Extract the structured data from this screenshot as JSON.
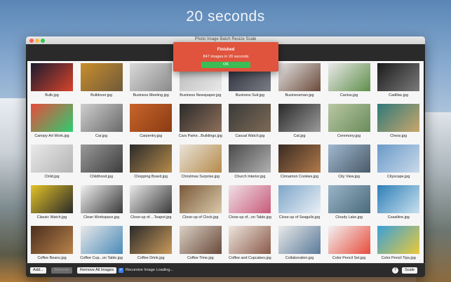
{
  "hero": {
    "title": "20 seconds"
  },
  "window": {
    "title": "Photo Image Batch Resize Scale"
  },
  "dialog": {
    "heading": "Finished",
    "message": "847 images in 20 seconds",
    "ok_label": "OK"
  },
  "bottombar": {
    "add_label": "Add...",
    "remove_label": "Remove",
    "remove_all_label": "Remove All Images",
    "recursive_label": "Recursive Image Loading...",
    "recursive_checked": true,
    "help_label": "?",
    "scale_label": "Scale"
  },
  "images": [
    {
      "name": "Bulb.jpg",
      "c1": "#1b1b2e",
      "c2": "#d7442c"
    },
    {
      "name": "Bulldozer.jpg",
      "c1": "#c98e2c",
      "c2": "#6f5a3a"
    },
    {
      "name": "Business Meeting.jpg",
      "c1": "#d9d9d9",
      "c2": "#8a8a8a"
    },
    {
      "name": "Business Newspaper.jpg",
      "c1": "#b9b9b9",
      "c2": "#e8e8e8"
    },
    {
      "name": "Business Suit.jpg",
      "c1": "#2a2d3a",
      "c2": "#7b7c85"
    },
    {
      "name": "Businessman.jpg",
      "c1": "#e2e2e2",
      "c2": "#6b4a3a"
    },
    {
      "name": "Cactus.jpg",
      "c1": "#e9e9e9",
      "c2": "#5f8f4a"
    },
    {
      "name": "Cadillac.jpg",
      "c1": "#1b1b1b",
      "c2": "#7a7a7a"
    },
    {
      "name": "Canopy Art Work.jpg",
      "c1": "#e74c3c",
      "c2": "#2ecc71"
    },
    {
      "name": "Car.jpg",
      "c1": "#cfcfcf",
      "c2": "#6a6a6a"
    },
    {
      "name": "Carpentry.jpg",
      "c1": "#c8652a",
      "c2": "#8a3b14"
    },
    {
      "name": "Cars Parke...Buildings.jpg",
      "c1": "#2b2b2b",
      "c2": "#8e6f5a"
    },
    {
      "name": "Casual Watch.jpg",
      "c1": "#3a3a3a",
      "c2": "#7d6a55"
    },
    {
      "name": "Cat.jpg",
      "c1": "#2a2a2a",
      "c2": "#9a9a9a"
    },
    {
      "name": "Ceremony.jpg",
      "c1": "#b9c7a4",
      "c2": "#6a8c5a"
    },
    {
      "name": "Chess.jpg",
      "c1": "#2f7a7a",
      "c2": "#c9a66b"
    },
    {
      "name": "Child.jpg",
      "c1": "#e9e9e9",
      "c2": "#b4b4b4"
    },
    {
      "name": "Childhood.jpg",
      "c1": "#9a9a9a",
      "c2": "#3d3d3d"
    },
    {
      "name": "Chopping Board.jpg",
      "c1": "#2b2b2b",
      "c2": "#b58a4a"
    },
    {
      "name": "Christmas Surprise.jpg",
      "c1": "#e9e3d9",
      "c2": "#b58a4a"
    },
    {
      "name": "Church Interior.jpg",
      "c1": "#4a4a4a",
      "c2": "#b0b0b0"
    },
    {
      "name": "Cinnamon Cookies.jpg",
      "c1": "#3a2a22",
      "c2": "#b07a4a"
    },
    {
      "name": "City View.jpg",
      "c1": "#9fb8cf",
      "c2": "#4a5a6a"
    },
    {
      "name": "Cityscape.jpg",
      "c1": "#6a9ac9",
      "c2": "#c9d9e9"
    },
    {
      "name": "Classic Watch.jpg",
      "c1": "#e3c227",
      "c2": "#2a2a2a"
    },
    {
      "name": "Clean Workspace.jpg",
      "c1": "#f1f1f1",
      "c2": "#3a3a3a"
    },
    {
      "name": "Close-up of....Teapot.jpg",
      "c1": "#e9e9e9",
      "c2": "#3a3a3a"
    },
    {
      "name": "Close-up of Clock.jpg",
      "c1": "#7a5a3a",
      "c2": "#d9c9a9"
    },
    {
      "name": "Close-up of...on Table.jpg",
      "c1": "#f0e0e6",
      "c2": "#c75a7a"
    },
    {
      "name": "Close-up of Seagulls.jpg",
      "c1": "#7ea6c9",
      "c2": "#e9eff5"
    },
    {
      "name": "Cloudy Lake.jpg",
      "c1": "#9ab4c9",
      "c2": "#4a6a7a"
    },
    {
      "name": "Coastline.jpg",
      "c1": "#2e7fb8",
      "c2": "#c9e0ee"
    },
    {
      "name": "Coffee Beans.jpg",
      "c1": "#4a2e1e",
      "c2": "#b8824a"
    },
    {
      "name": "Coffee Cup...on Table.jpg",
      "c1": "#e9e9e9",
      "c2": "#4a8ab8"
    },
    {
      "name": "Coffee Drink.jpg",
      "c1": "#2a2a2a",
      "c2": "#c99a5a"
    },
    {
      "name": "Coffee Time.jpg",
      "c1": "#d9d0c4",
      "c2": "#6a4a3a"
    },
    {
      "name": "Coffee and Cupcakes.jpg",
      "c1": "#ede5dd",
      "c2": "#8a5a4a"
    },
    {
      "name": "Collaboration.jpg",
      "c1": "#e9e9e9",
      "c2": "#5a7a9a"
    },
    {
      "name": "Color Pencil Set.jpg",
      "c1": "#f2f2f2",
      "c2": "#e74c3c"
    },
    {
      "name": "Color Pencil Tips.jpg",
      "c1": "#3aa0d9",
      "c2": "#e9c93a"
    }
  ]
}
